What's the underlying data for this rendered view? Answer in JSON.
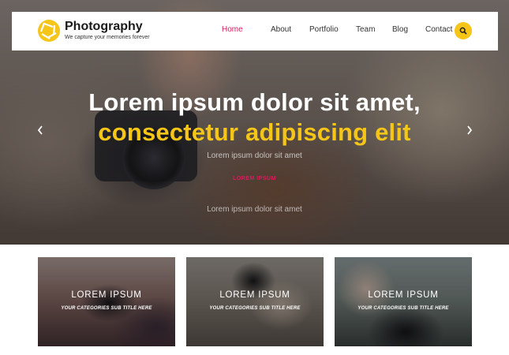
{
  "colors": {
    "accent_yellow": "#f5c518",
    "accent_pink": "#d81b60",
    "header_bg": "#ffffff",
    "text_dark": "#1a1a1a"
  },
  "brand": {
    "logo_icon": "aperture-icon",
    "title": "Photography",
    "tagline": "We capture your memories forever"
  },
  "nav": {
    "items": [
      {
        "label": "Home",
        "active": true
      },
      {
        "label": "About",
        "active": false
      },
      {
        "label": "Portfolio",
        "active": false
      },
      {
        "label": "Team",
        "active": false
      },
      {
        "label": "Blog",
        "active": false
      },
      {
        "label": "Contact",
        "active": false
      }
    ],
    "search_icon": "search-icon"
  },
  "hero": {
    "title_line1": "Lorem ipsum dolor sit amet,",
    "title_line2": "consectetur adipiscing elit",
    "subtitle": "Lorem ipsum dolor sit amet",
    "link_label": "LOREM IPSUM",
    "subtitle2": "Lorem ipsum dolor sit amet",
    "prev_icon": "chevron-left-icon",
    "next_icon": "chevron-right-icon"
  },
  "cards": [
    {
      "title": "LOREM IPSUM",
      "subtitle": "YOUR CATEGORIES SUB TITLE HERE"
    },
    {
      "title": "LOREM IPSUM",
      "subtitle": "YOUR CATEGORIES SUB TITLE HERE"
    },
    {
      "title": "LOREM IPSUM",
      "subtitle": "YOUR CATEGORIES SUB TITLE HERE"
    }
  ]
}
